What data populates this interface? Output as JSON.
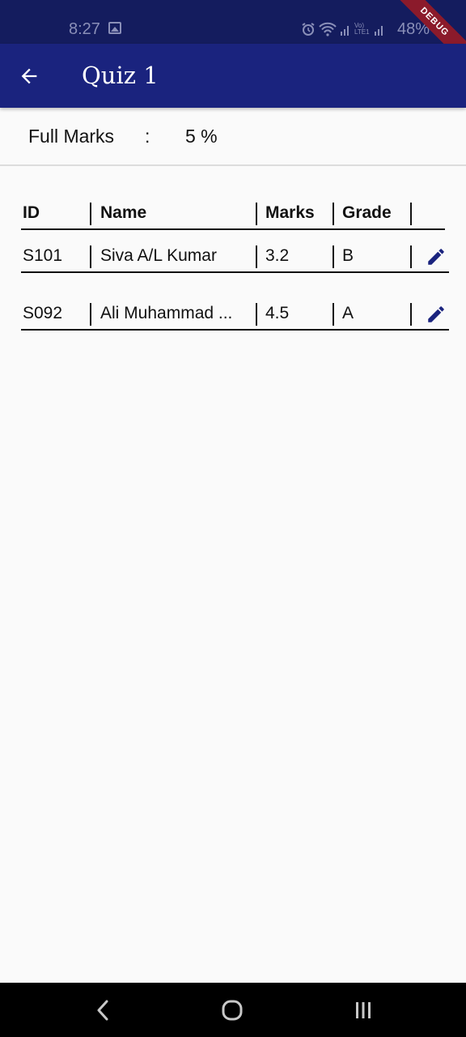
{
  "status_bar": {
    "time": "8:27",
    "volte_text": "Vo) LTE1",
    "battery": "48%"
  },
  "debug_label": "DEBUG",
  "app_bar": {
    "title": "Quiz 1"
  },
  "full_marks": {
    "label": "Full Marks",
    "separator": ":",
    "value": "5 %"
  },
  "table": {
    "headers": [
      "ID",
      "Name",
      "Marks",
      "Grade"
    ],
    "rows": [
      {
        "id": "S101",
        "name": "Siva A/L Kumar",
        "marks": "3.2",
        "grade": "B"
      },
      {
        "id": "S092",
        "name": "Ali Muhammad ...",
        "marks": "4.5",
        "grade": "A"
      }
    ]
  },
  "colors": {
    "status_bar": "#141c5e",
    "app_bar": "#1a237e",
    "accent": "#1a237e",
    "nav_bar": "#000000"
  }
}
